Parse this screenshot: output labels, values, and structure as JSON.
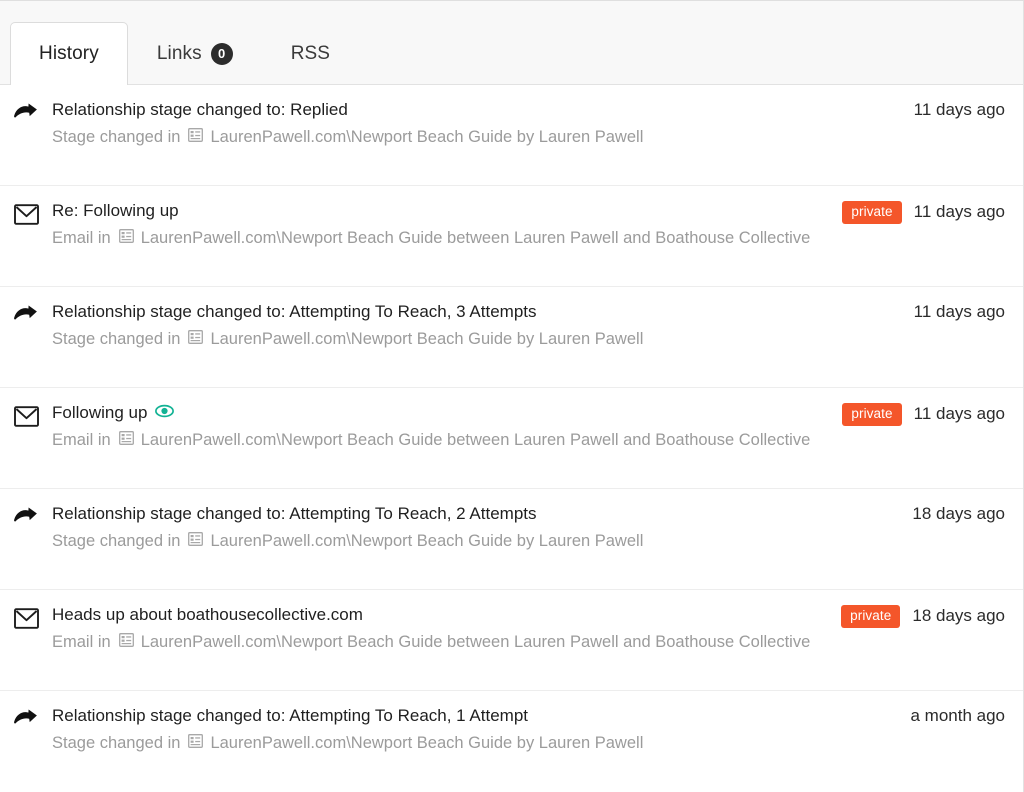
{
  "window": {
    "accent_orange": "#f4562a",
    "accent_teal": "#12b294",
    "badge_dark": "#2c2c2c"
  },
  "tabs": [
    {
      "id": "history",
      "label": "History",
      "active": true,
      "count": null
    },
    {
      "id": "links",
      "label": "Links",
      "active": false,
      "count": "0"
    },
    {
      "id": "rss",
      "label": "RSS",
      "active": false,
      "count": null
    }
  ],
  "history": {
    "rows": [
      {
        "icon": "stage-change-arrow-icon",
        "title": "Relationship stage changed to: Replied",
        "viewed": false,
        "sub_prefix": "Stage changed in",
        "sub_context_icon": "project-list-icon",
        "sub_context": "LaurenPawell.com\\Newport Beach Guide by Lauren Pawell",
        "privacy": null,
        "timeago": "11 days ago"
      },
      {
        "icon": "email-envelope-icon",
        "title": "Re: Following up",
        "viewed": false,
        "sub_prefix": "Email in",
        "sub_context_icon": "project-list-icon",
        "sub_context": "LaurenPawell.com\\Newport Beach Guide between Lauren Pawell and Boathouse Collective",
        "privacy": "private",
        "timeago": "11 days ago"
      },
      {
        "icon": "stage-change-arrow-icon",
        "title": "Relationship stage changed to: Attempting To Reach, 3 Attempts",
        "viewed": false,
        "sub_prefix": "Stage changed in",
        "sub_context_icon": "project-list-icon",
        "sub_context": "LaurenPawell.com\\Newport Beach Guide by Lauren Pawell",
        "privacy": null,
        "timeago": "11 days ago"
      },
      {
        "icon": "email-envelope-icon",
        "title": "Following up",
        "viewed": true,
        "sub_prefix": "Email in",
        "sub_context_icon": "project-list-icon",
        "sub_context": "LaurenPawell.com\\Newport Beach Guide between Lauren Pawell and Boathouse Collective",
        "privacy": "private",
        "timeago": "11 days ago"
      },
      {
        "icon": "stage-change-arrow-icon",
        "title": "Relationship stage changed to: Attempting To Reach, 2 Attempts",
        "viewed": false,
        "sub_prefix": "Stage changed in",
        "sub_context_icon": "project-list-icon",
        "sub_context": "LaurenPawell.com\\Newport Beach Guide by Lauren Pawell",
        "privacy": null,
        "timeago": "18 days ago"
      },
      {
        "icon": "email-envelope-icon",
        "title": "Heads up about boathousecollective.com",
        "viewed": false,
        "sub_prefix": "Email in",
        "sub_context_icon": "project-list-icon",
        "sub_context": "LaurenPawell.com\\Newport Beach Guide between Lauren Pawell and Boathouse Collective",
        "privacy": "private",
        "timeago": "18 days ago"
      },
      {
        "icon": "stage-change-arrow-icon",
        "title": "Relationship stage changed to: Attempting To Reach, 1 Attempt",
        "viewed": false,
        "sub_prefix": "Stage changed in",
        "sub_context_icon": "project-list-icon",
        "sub_context": "LaurenPawell.com\\Newport Beach Guide by Lauren Pawell",
        "privacy": null,
        "timeago": "a month ago"
      }
    ]
  }
}
